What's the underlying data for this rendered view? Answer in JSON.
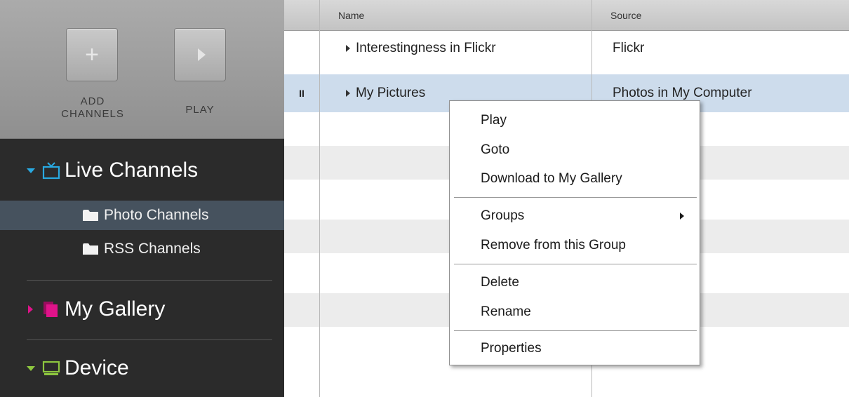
{
  "toolbar": {
    "add_label": "ADD\nCHANNELS",
    "play_label": "PLAY"
  },
  "sidebar": {
    "sections": [
      {
        "title": "Live Channels",
        "icon": "tv-icon",
        "accent": "#29a9e1",
        "expanded": true
      },
      {
        "title": "My Gallery",
        "icon": "gallery-icon",
        "accent": "#e0138a",
        "expanded": false
      },
      {
        "title": "Device",
        "icon": "monitor-icon",
        "accent": "#8dc63f",
        "expanded": true
      }
    ],
    "live_items": [
      {
        "label": "Photo Channels",
        "icon": "folder-icon",
        "selected": true
      },
      {
        "label": "RSS Channels",
        "icon": "folder-icon",
        "selected": false
      }
    ]
  },
  "table": {
    "columns": [
      "Name",
      "Source"
    ],
    "rows": [
      {
        "mark": "",
        "name": "Interestingness in Flickr",
        "source": "Flickr"
      },
      {
        "mark": "II",
        "name": "My Pictures",
        "source": "Photos in My Computer",
        "selected": true
      }
    ]
  },
  "context_menu": {
    "items": [
      "Play",
      "Goto",
      "Download to My Gallery",
      "Groups",
      "Remove from this Group",
      "Delete",
      "Rename",
      "Properties"
    ]
  },
  "colors": {
    "sidebar_bg": "#2b2b2b",
    "selected_sidebar_item": "#46525e",
    "selected_row": "#cddcec",
    "live_accent": "#29a9e1",
    "gallery_accent": "#e0138a",
    "device_accent": "#8dc63f"
  }
}
